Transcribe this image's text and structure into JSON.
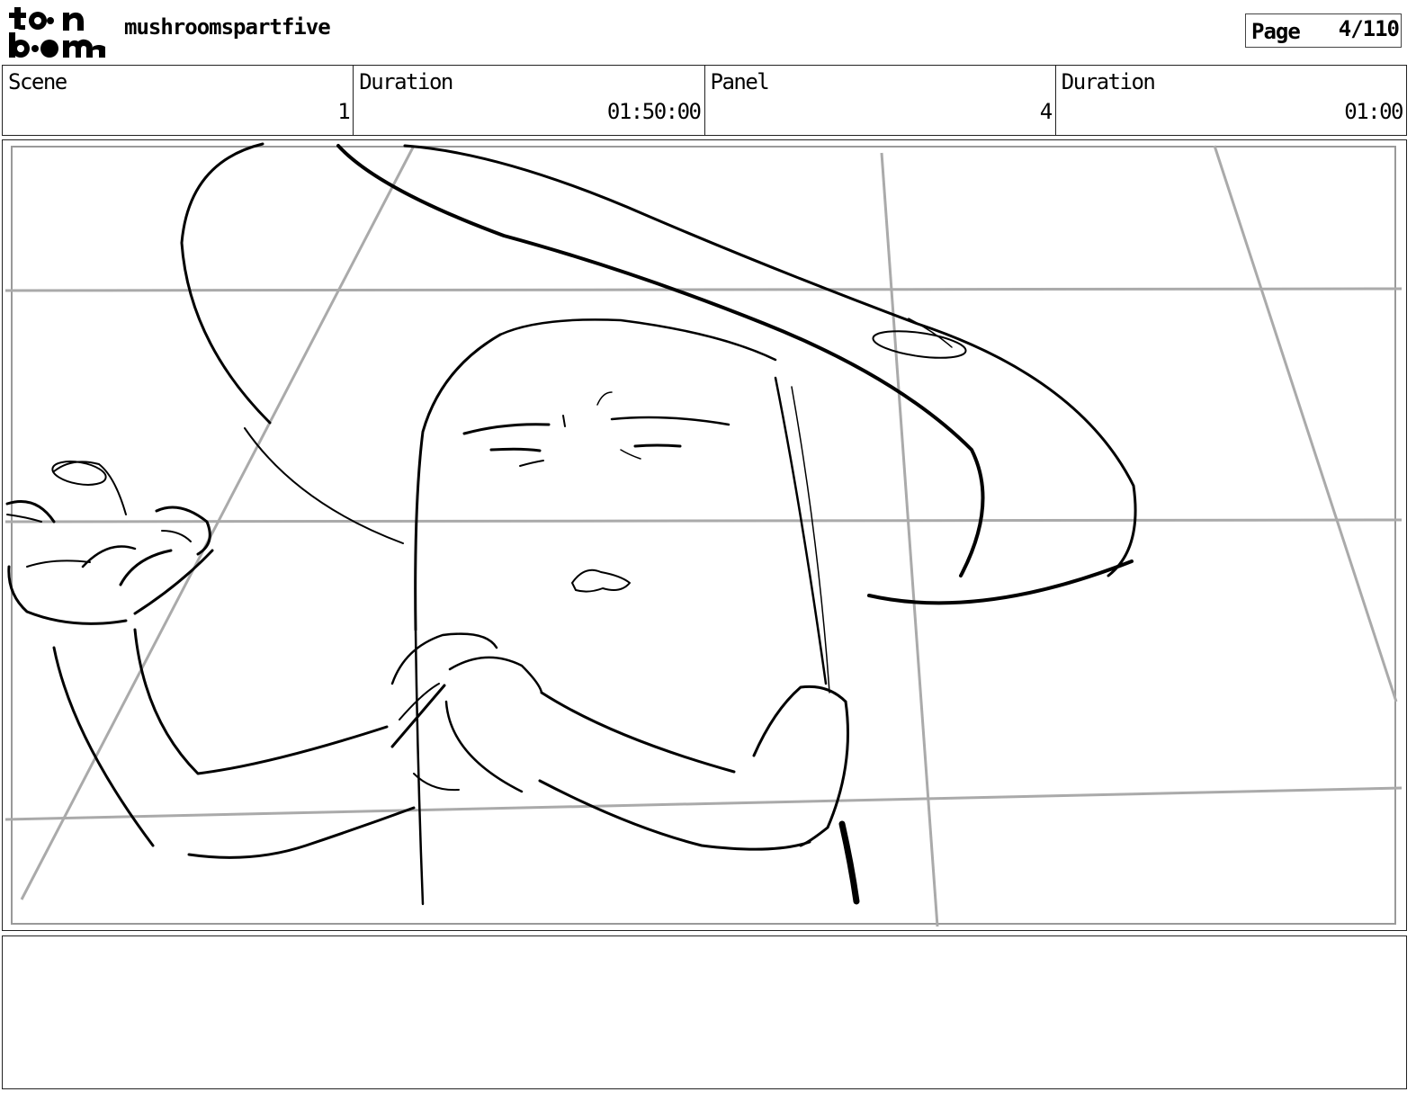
{
  "header": {
    "logo": {
      "name": "toon-boom-logo",
      "text": "toon boom"
    },
    "project_title": "mushroomspartfive",
    "page_label": "Page",
    "page_value": "4/110"
  },
  "info": {
    "scene_label": "Scene",
    "scene_value": "1",
    "scene_duration_label": "Duration",
    "scene_duration_value": "01:50:00",
    "panel_label": "Panel",
    "panel_value": "4",
    "panel_duration_label": "Duration",
    "panel_duration_value": "01:00"
  },
  "colors": {
    "ink": "#000000",
    "guide_gray": "#aaaaaa",
    "frame_gray": "#999999"
  }
}
